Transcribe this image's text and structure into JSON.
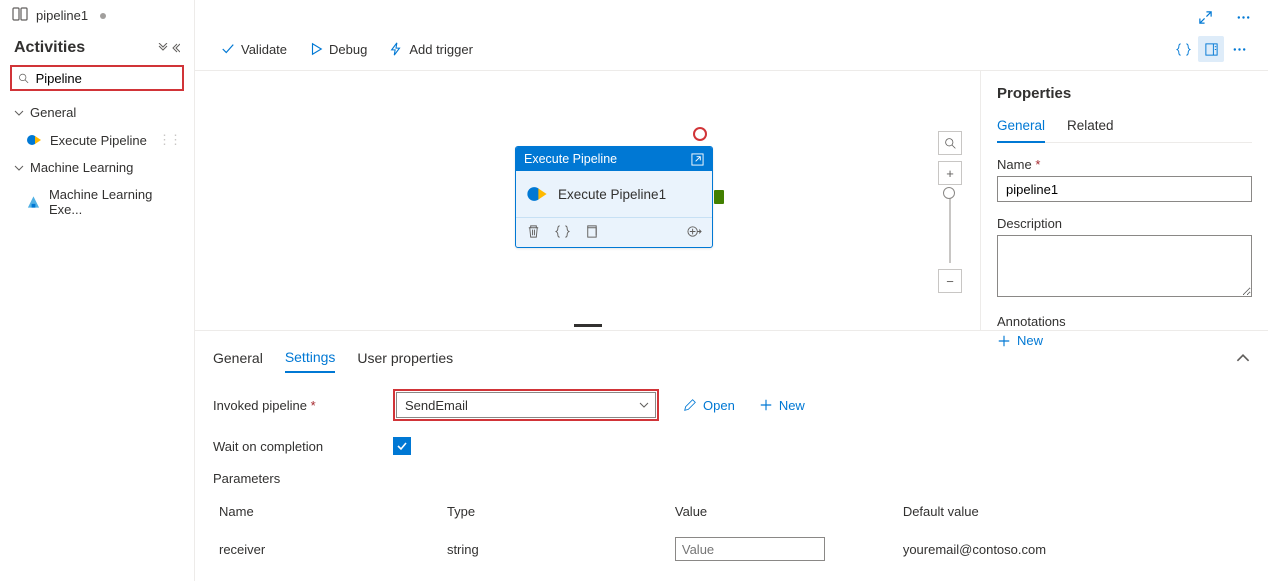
{
  "pipeline_tab": {
    "name": "pipeline1"
  },
  "sidebar": {
    "title": "Activities",
    "search_value": "Pipeline",
    "groups": [
      {
        "name": "General",
        "items": [
          {
            "label": "Execute Pipeline"
          }
        ]
      },
      {
        "name": "Machine Learning",
        "items": [
          {
            "label": "Machine Learning Exe..."
          }
        ]
      }
    ]
  },
  "toolbar": {
    "validate": "Validate",
    "debug": "Debug",
    "add_trigger": "Add trigger"
  },
  "node": {
    "type": "Execute Pipeline",
    "title": "Execute Pipeline1"
  },
  "bottom": {
    "tabs": {
      "general": "General",
      "settings": "Settings",
      "user_props": "User properties"
    },
    "invoked_label": "Invoked pipeline",
    "invoked_value": "SendEmail",
    "open": "Open",
    "new": "New",
    "wait_label": "Wait on completion",
    "wait_checked": true,
    "params_label": "Parameters",
    "cols": {
      "name": "Name",
      "type": "Type",
      "value": "Value",
      "default": "Default value"
    },
    "rows": [
      {
        "name": "receiver",
        "type": "string",
        "value_ph": "Value",
        "default": "youremail@contoso.com"
      }
    ]
  },
  "props": {
    "title": "Properties",
    "tabs": {
      "general": "General",
      "related": "Related"
    },
    "name_label": "Name",
    "name_value": "pipeline1",
    "desc_label": "Description",
    "annot_label": "Annotations",
    "new": "New"
  }
}
